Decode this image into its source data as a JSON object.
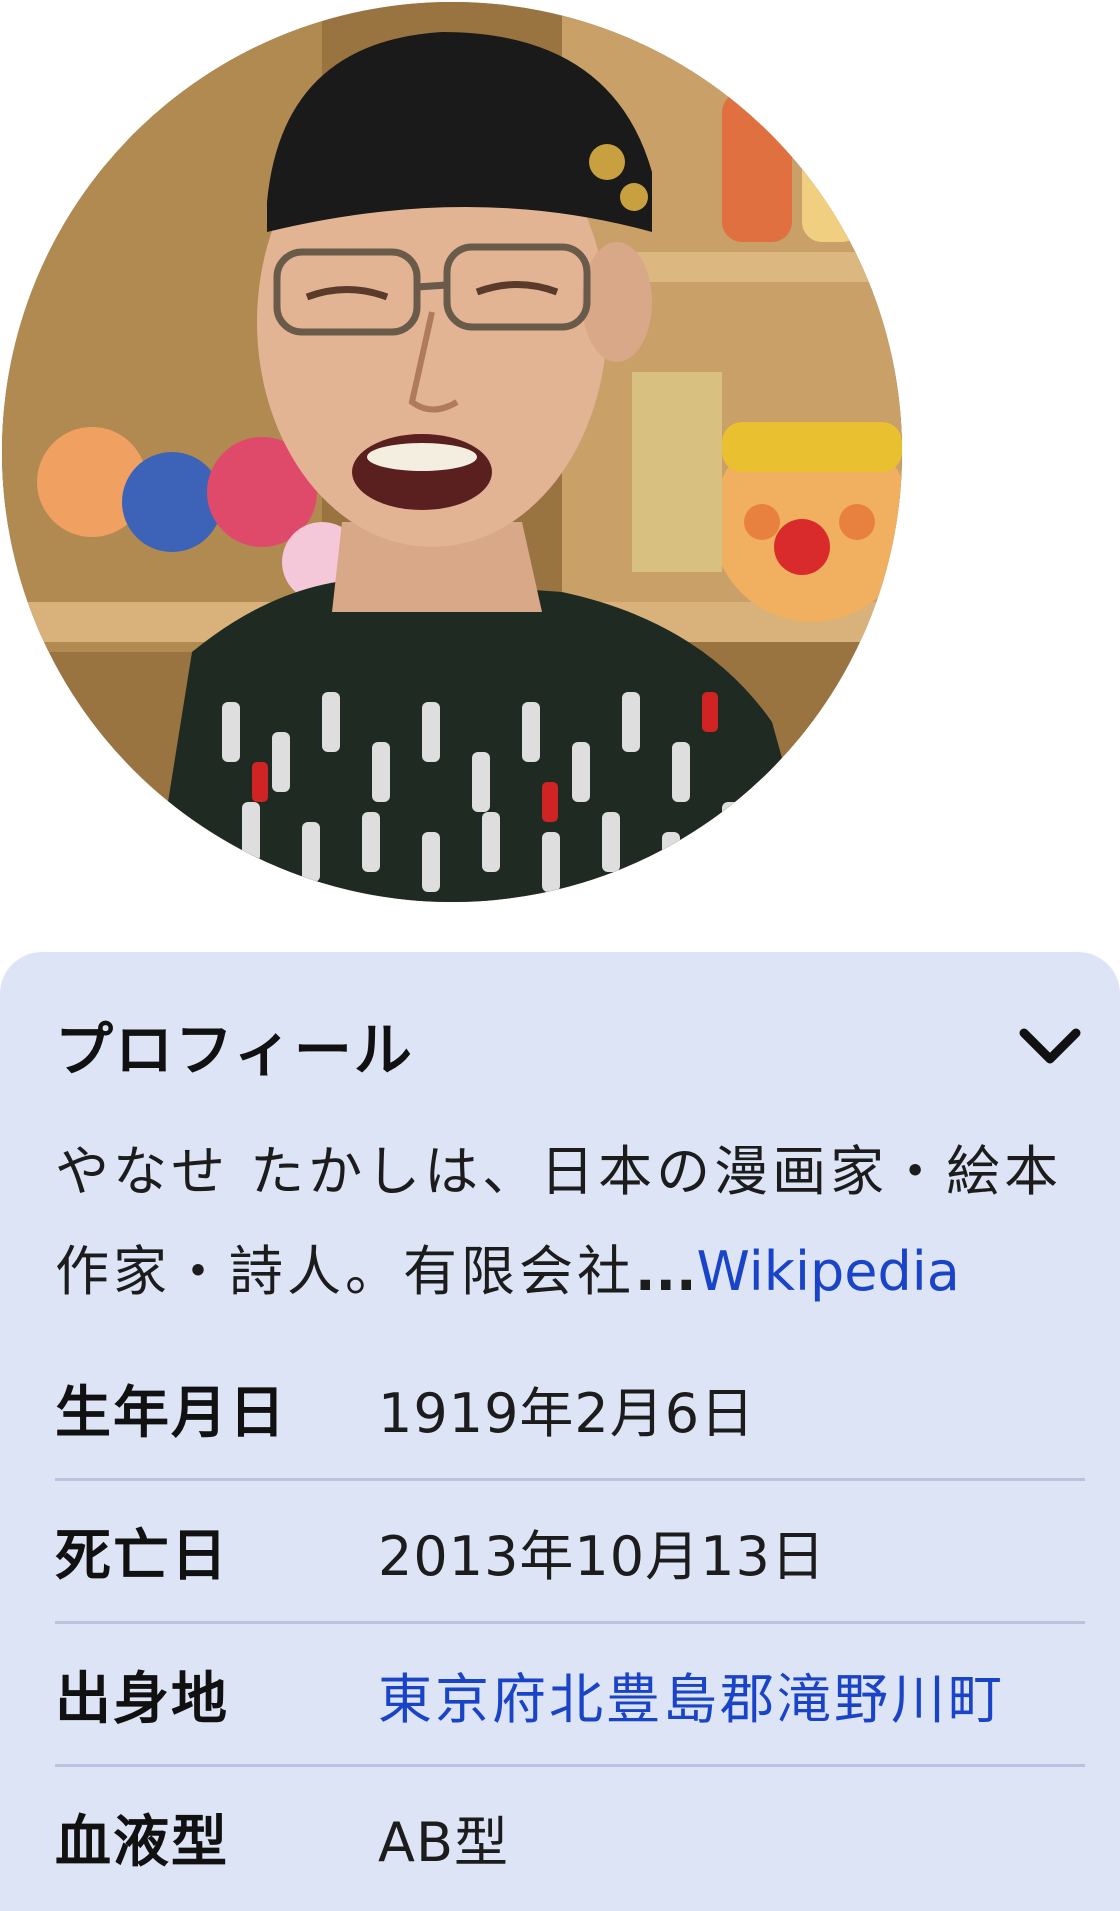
{
  "profile_card": {
    "title": "プロフィール",
    "expand_icon": "chevron-down-icon",
    "description": "やなせ たかしは、日本の漫画家・絵本作家・詩人。有限会社",
    "description_ellipsis": "...",
    "source_link": "Wikipedia",
    "facts": [
      {
        "label": "生年月日",
        "value": "1919年2月6日"
      },
      {
        "label": "死亡日",
        "value": "2013年10月13日"
      },
      {
        "label": "出身地",
        "value": "東京府北豊島郡滝野川町"
      },
      {
        "label": "血液型",
        "value": "AB型"
      }
    ]
  },
  "colors": {
    "card_background": "#dde4f6",
    "link": "#1a44c8",
    "divider": "#b9c3df"
  }
}
